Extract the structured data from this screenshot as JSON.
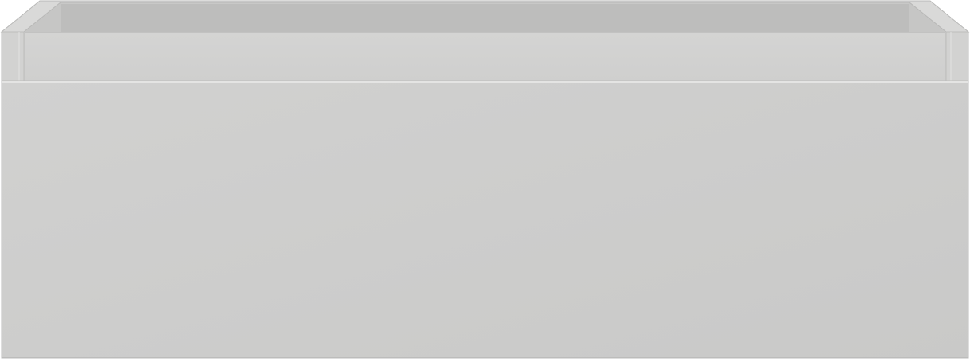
{
  "object": {
    "kind": "drawer-unit",
    "colors": {
      "background": "#ffffff",
      "inner_back_wall": "#bdbdbc",
      "inner_back_edge": "#c8c8c7",
      "inner_side_wall": "#c6c6c5",
      "top_rim": "#d9d9d8",
      "rim_outline": "#b8b8b7",
      "rail_face": "#cfcfce",
      "rail_shadow": "#c2c2c1",
      "corner_post": "#d2d2d1",
      "front_panel_light": "#d1d1d0",
      "front_panel_dark": "#c9c9c8",
      "front_panel_edge": "#e4e4e3"
    }
  }
}
